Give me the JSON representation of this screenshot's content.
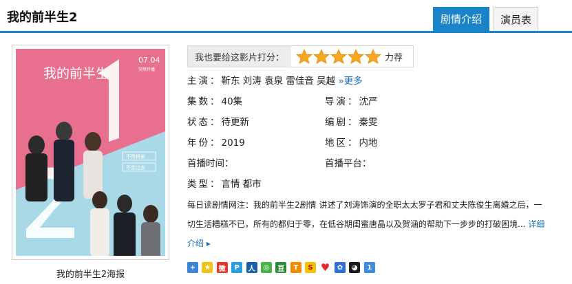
{
  "header": {
    "title": "我的前半生2",
    "tabs": [
      {
        "label": "剧情介绍",
        "active": true
      },
      {
        "label": "演员表",
        "active": false
      }
    ]
  },
  "poster": {
    "caption": "我的前半生2海报",
    "art_title": "我的前半生",
    "date": "07.04",
    "tagline": "突然开播",
    "slogans": [
      "不畏将来",
      "不念过去"
    ],
    "colors": {
      "top": "#e86f8d",
      "bottom": "#a9d9e6"
    }
  },
  "rating": {
    "label": "我也要给这影片打分：",
    "stars": 5,
    "text": "力荐",
    "star_color": "#f5a623"
  },
  "info": {
    "cast": {
      "label": "主演：",
      "value": "靳东 刘涛 袁泉 雷佳音 吴越",
      "more": "»更多"
    },
    "episodes": {
      "label": "集数：",
      "value": "40集"
    },
    "director": {
      "label": "导演：",
      "value": "沈严"
    },
    "status": {
      "label": "状态：",
      "value": "待更新"
    },
    "writer": {
      "label": "编剧：",
      "value": "秦雯"
    },
    "year": {
      "label": "年份：",
      "value": "2019"
    },
    "region": {
      "label": "地区：",
      "value": "内地"
    },
    "premiere_time": {
      "label": "首播时间：",
      "value": ""
    },
    "premiere_platform": {
      "label": "首播平台：",
      "value": ""
    },
    "genre": {
      "label": "类型：",
      "value": "言情 都市"
    }
  },
  "description": {
    "line1": "每日读剧情网注：我的前半生2剧情 讲述了刘涛饰演的全职太太罗子君和丈夫陈俊生离婚之后，一",
    "line2": "切生活糟糕不已，所有的都归于零，在低谷期闺蜜唐晶以及贺涵的帮助下一步步的打破困境...",
    "link": "详细介绍"
  },
  "share_icons": [
    "plus-icon",
    "qzone-icon",
    "weibo-icon",
    "qq-icon",
    "renren-icon",
    "wechat-icon",
    "douban-icon",
    "tieba-icon",
    "sohu-icon",
    "heart-icon",
    "baidu-icon",
    "penguin-icon",
    "one-icon"
  ],
  "accent": "#1a84c8"
}
